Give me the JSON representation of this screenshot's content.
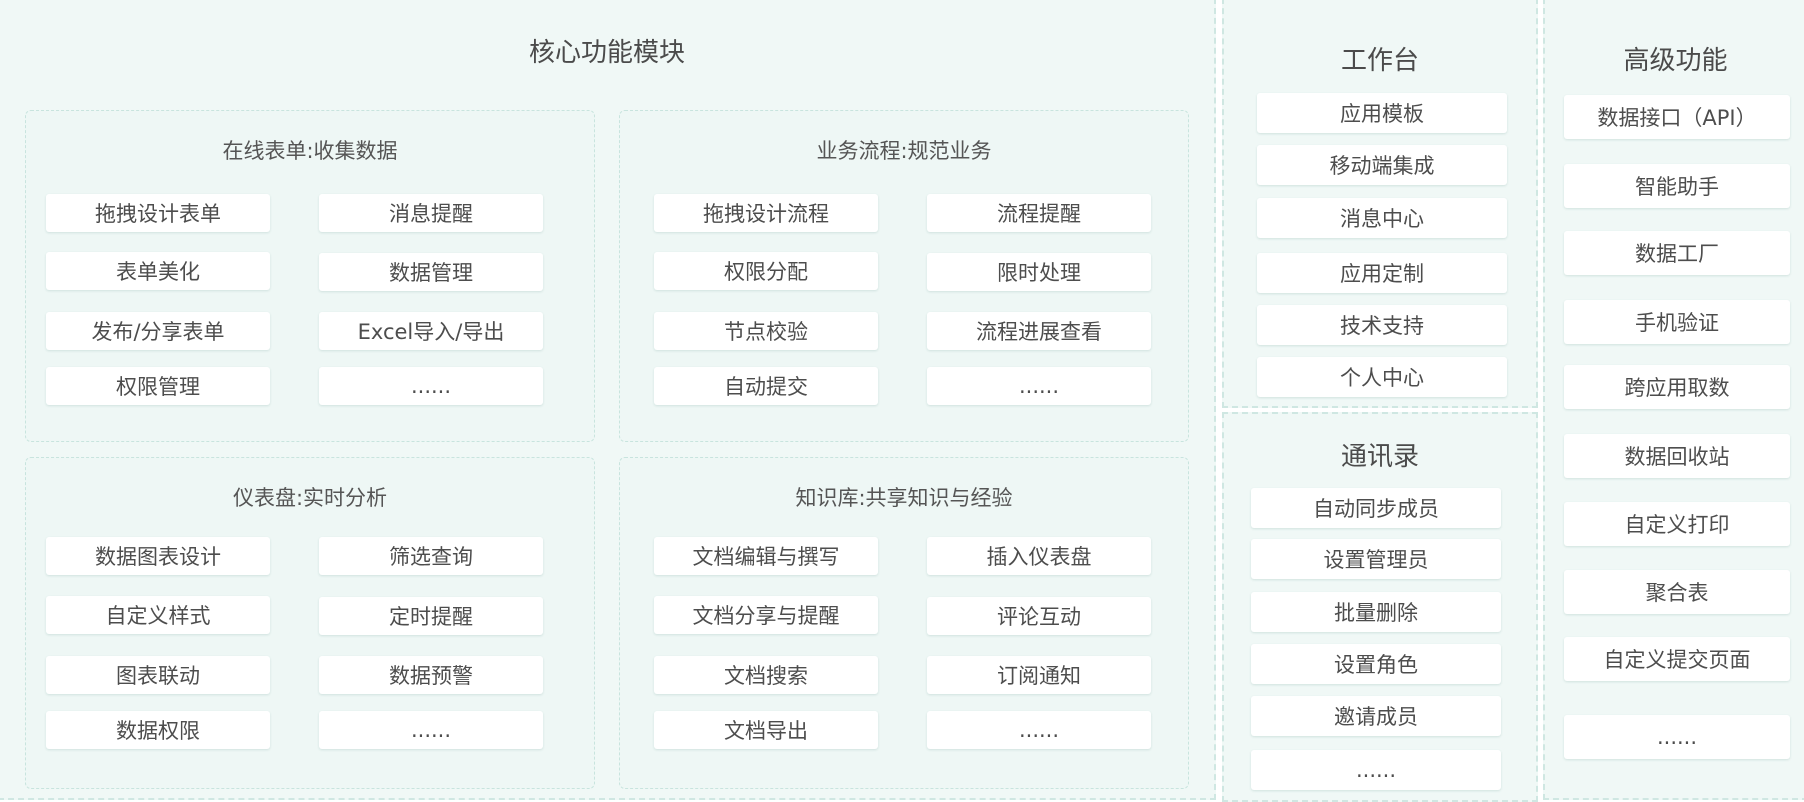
{
  "core": {
    "title": "核心功能模块",
    "groups": [
      {
        "title": "在线表单:收集数据",
        "items": [
          "拖拽设计表单",
          "消息提醒",
          "表单美化",
          "数据管理",
          "发布/分享表单",
          "Excel导入/导出",
          "权限管理",
          "......"
        ]
      },
      {
        "title": "业务流程:规范业务",
        "items": [
          "拖拽设计流程",
          "流程提醒",
          "权限分配",
          "限时处理",
          "节点校验",
          "流程进展查看",
          "自动提交",
          "......"
        ]
      },
      {
        "title": "仪表盘:实时分析",
        "items": [
          "数据图表设计",
          "筛选查询",
          "自定义样式",
          "定时提醒",
          "图表联动",
          "数据预警",
          "数据权限",
          "......"
        ]
      },
      {
        "title": "知识库:共享知识与经验",
        "items": [
          "文档编辑与撰写",
          "插入仪表盘",
          "文档分享与提醒",
          "评论互动",
          "文档搜索",
          "订阅通知",
          "文档导出",
          "......"
        ]
      }
    ]
  },
  "workbench": {
    "title": "工作台",
    "items": [
      "应用模板",
      "移动端集成",
      "消息中心",
      "应用定制",
      "技术支持",
      "个人中心"
    ]
  },
  "contacts": {
    "title": "通讯录",
    "items": [
      "自动同步成员",
      "设置管理员",
      "批量删除",
      "设置角色",
      "邀请成员",
      "......"
    ]
  },
  "advanced": {
    "title": "高级功能",
    "items": [
      "数据接口（API）",
      "智能助手",
      "数据工厂",
      "手机验证",
      "跨应用取数",
      "数据回收站",
      "自定义打印",
      "聚合表",
      "自定义提交页面",
      "......"
    ]
  }
}
